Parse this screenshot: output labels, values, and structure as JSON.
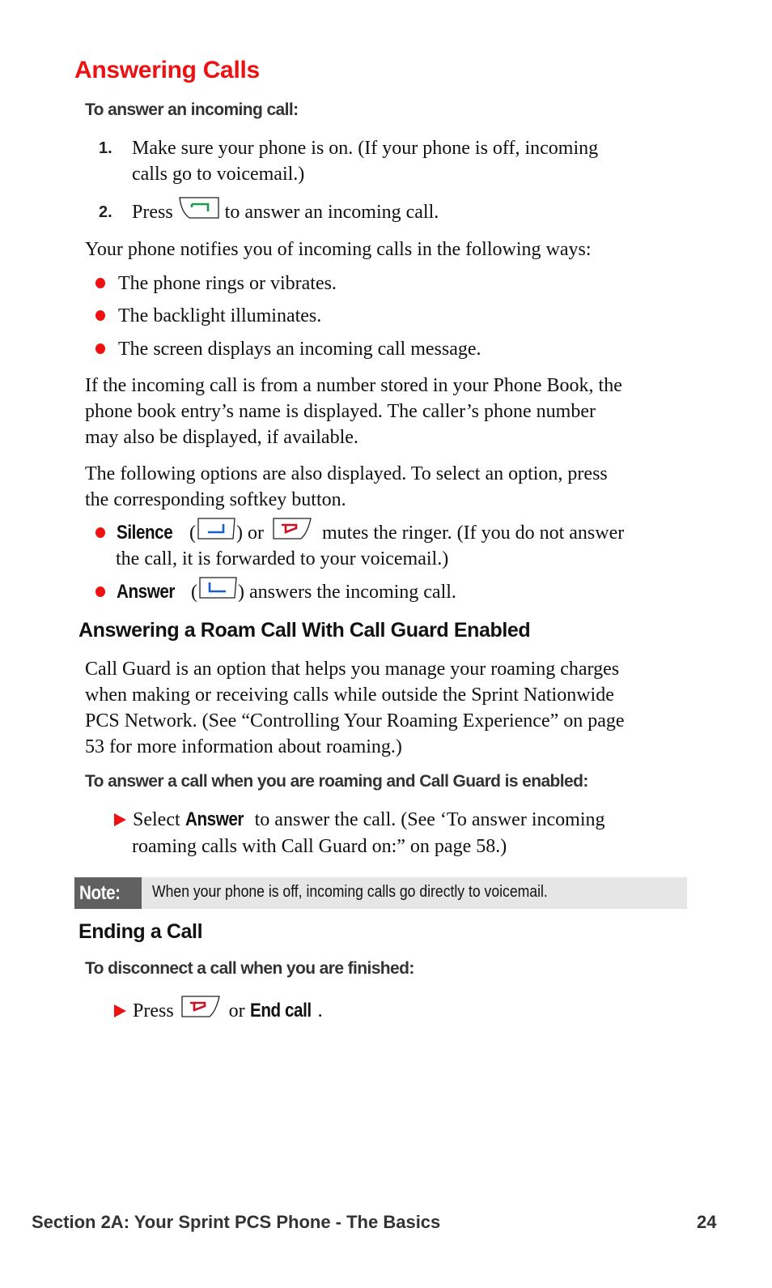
{
  "page": {
    "title": "Answering Calls",
    "colors": {
      "accent": "#ee1111",
      "note_label_bg": "#606060",
      "note_bg": "#e6e6e6",
      "talk_key": "#1a9a4a",
      "softkey": "#1a5fc8",
      "end_key": "#cc1122"
    }
  },
  "answer_section": {
    "procedure_heading": "To answer an incoming call:",
    "steps": [
      {
        "number": "1.",
        "text_line1": "Make sure your phone is on. (If your phone is off, incoming",
        "text_line2": "calls go to voicemail.)"
      },
      {
        "number": "2.",
        "before_icon": "Press",
        "icon": "talk-key-icon",
        "after_icon": "to answer an incoming call."
      }
    ],
    "notify_intro": "Your phone notifies you of incoming calls in the following ways:",
    "notify_items": [
      "The phone rings or vibrates.",
      "The backlight illuminates.",
      "The screen displays an incoming call message."
    ],
    "phonebook_para": {
      "line1": "If the incoming call is from a number stored in your Phone Book, the",
      "line2": "phone book entry’s name is displayed. The caller’s phone number",
      "line3": "may also be displayed, if available."
    },
    "options_para": {
      "line1": "The following options are also displayed. To select an option, press",
      "line2": "the corresponding softkey button."
    },
    "options": [
      {
        "label": "Silence",
        "open": "(",
        "icon1": "right-softkey-icon",
        "mid": ") or",
        "icon2": "end-key-icon",
        "desc_line1": "mutes the ringer. (If you do not answer",
        "desc_line2": "the call, it is forwarded to your voicemail.)"
      },
      {
        "label": "Answer",
        "open": "(",
        "icon1": "left-softkey-icon",
        "desc_line1": ") answers the incoming call."
      }
    ]
  },
  "roam_section": {
    "heading": "Answering a Roam Call With Call Guard Enabled",
    "para": {
      "line1": "Call Guard is an option that helps you manage your roaming charges",
      "line2": "when making or receiving calls while outside the Sprint Nationwide",
      "line3": "PCS Network. (See “Controlling Your Roaming Experience” on page",
      "line4": "53 for more information about roaming.)"
    },
    "procedure_heading": "To answer a call when you are roaming and Call Guard is enabled:",
    "step": {
      "before": "Select",
      "bold": "Answer",
      "after_line1": "to answer the call. (See ‘To answer incoming",
      "line2": "roaming calls with Call Guard on:” on page 58.)"
    }
  },
  "note": {
    "label": "Note:",
    "text": "When your phone is off, incoming calls go directly to voicemail."
  },
  "ending_section": {
    "heading": "Ending a Call",
    "procedure_heading": "To disconnect a call when you are finished:",
    "step": {
      "before": "Press",
      "icon": "end-key-icon",
      "mid": "or",
      "bold": "End call",
      "end": "."
    }
  },
  "footer": {
    "section": "Section 2A: Your Sprint PCS Phone - The Basics",
    "page_number": "24"
  }
}
